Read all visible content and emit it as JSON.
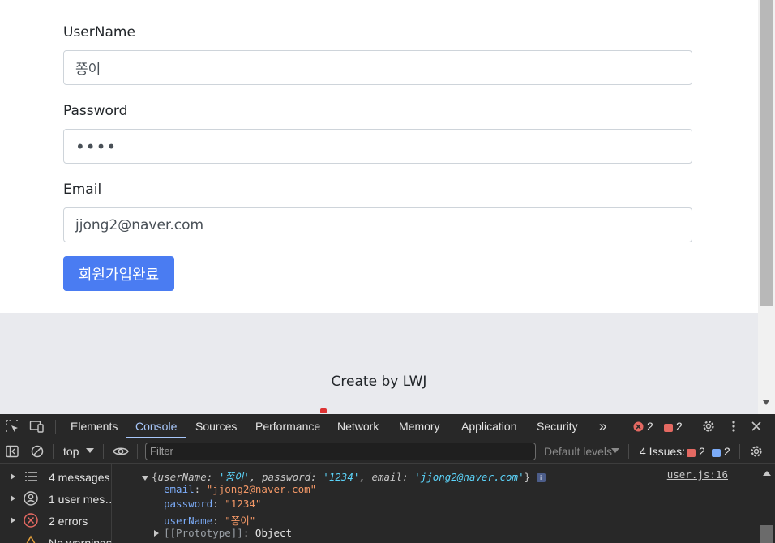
{
  "form": {
    "username_label": "UserName",
    "username_value": "쫑이",
    "password_label": "Password",
    "password_value": "••••",
    "email_label": "Email",
    "email_value": "jjong2@naver.com",
    "submit_label": "회원가입완료"
  },
  "footer": {
    "text": "Create by LWJ"
  },
  "devtools": {
    "tabs": [
      "Elements",
      "Console",
      "Sources",
      "Performance",
      "Network",
      "Memory",
      "Application",
      "Security"
    ],
    "active_tab": "Console",
    "more_tabs": "»",
    "error_count": "2",
    "issue_count": "2",
    "toolbar": {
      "context": "top",
      "filter_placeholder": "Filter",
      "levels": "Default levels",
      "issues_label": "4 Issues:",
      "issues_red": "2",
      "issues_blue": "2"
    },
    "sidebar": [
      {
        "label": "4 messages",
        "icon": "list-icon"
      },
      {
        "label": "1 user mes…",
        "icon": "user-icon"
      },
      {
        "label": "2 errors",
        "icon": "error-icon"
      },
      {
        "label": "No warnings",
        "icon": "warning-icon"
      }
    ],
    "console": {
      "summary_open": "{",
      "summary_k1": "userName",
      "summary_v1": "'쫑이'",
      "summary_k2": "password",
      "summary_v2": "'1234'",
      "summary_k3": "email",
      "summary_v3": "'jjong2@naver.com'",
      "summary_close": "}",
      "source": "user.js:16",
      "props": [
        {
          "key": "email",
          "value": "\"jjong2@naver.com\""
        },
        {
          "key": "password",
          "value": "\"1234\""
        },
        {
          "key": "userName",
          "value": "\"쫑이\""
        }
      ],
      "prototype_key": "[[Prototype]]",
      "prototype_value": "Object"
    }
  }
}
